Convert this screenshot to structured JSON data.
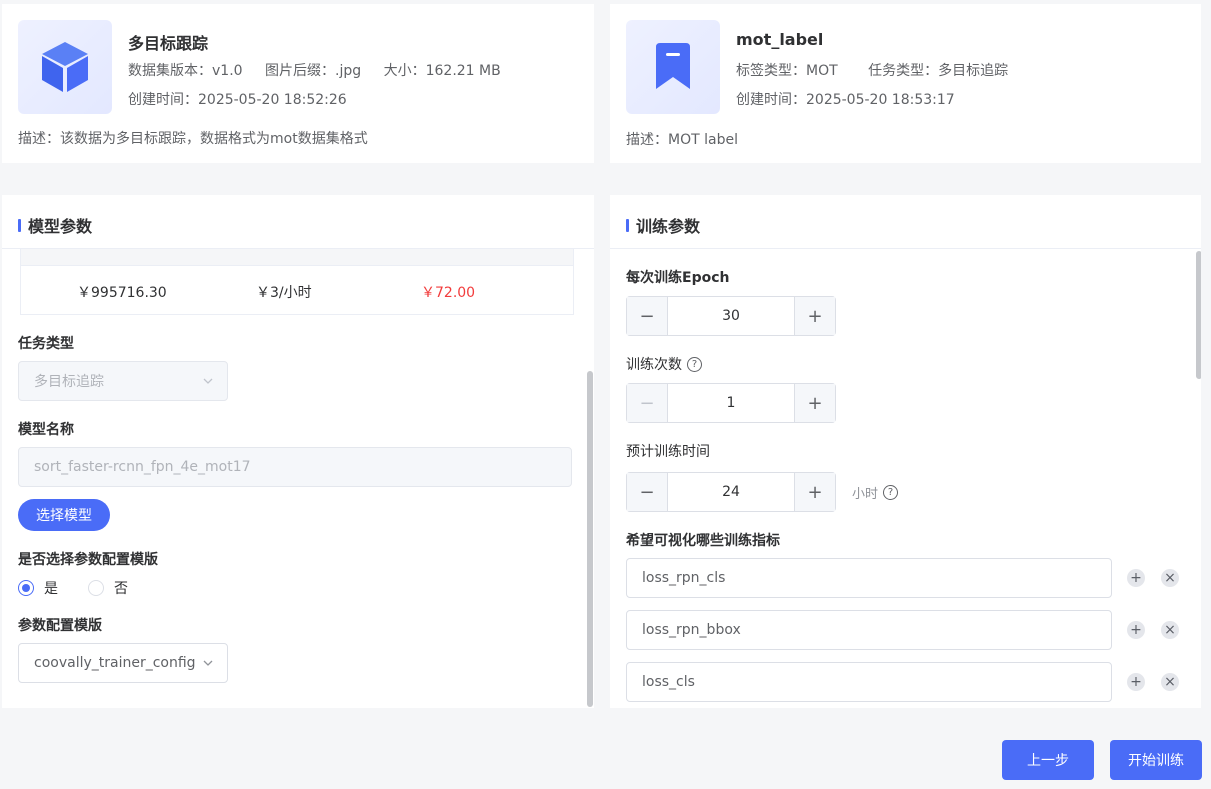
{
  "dataset_card": {
    "title": "多目标跟踪",
    "version_label": "数据集版本：",
    "version": "v1.0",
    "suffix_label": "图片后缀：",
    "suffix": ".jpg",
    "size_label": "大小：",
    "size": "162.21 MB",
    "created_label": "创建时间：",
    "created": "2025-05-20 18:52:26",
    "desc_label": "描述：",
    "desc": "该数据为多目标跟踪，数据格式为mot数据集格式",
    "icon": "cube-icon"
  },
  "label_card": {
    "title": "mot_label",
    "label_type_label": "标签类型：",
    "label_type": "MOT",
    "task_type_label": "任务类型：",
    "task_type": "多目标追踪",
    "created_label": "创建时间：",
    "created": "2025-05-20 18:53:17",
    "desc_label": "描述：",
    "desc": "MOT label",
    "icon": "bookmark-icon"
  },
  "model_params": {
    "title": "模型参数",
    "price_row": {
      "balance": "￥995716.30",
      "rate": "￥3/小时",
      "total": "￥72.00"
    },
    "task_type_label": "任务类型",
    "task_type_value": "多目标追踪",
    "model_name_label": "模型名称",
    "model_name_value": "sort_faster-rcnn_fpn_4e_mot17",
    "select_model_button": "选择模型",
    "use_template_label": "是否选择参数配置模版",
    "radio_yes": "是",
    "radio_no": "否",
    "template_label": "参数配置模版",
    "template_value": "coovally_trainer_config"
  },
  "train_params": {
    "title": "训练参数",
    "epoch_label": "每次训练Epoch",
    "epoch_value": "30",
    "times_label": "训练次数",
    "times_value": "1",
    "est_time_label": "预计训练时间",
    "est_time_value": "24",
    "est_time_unit": "小时",
    "metrics_label": "希望可视化哪些训练指标",
    "metrics": [
      "loss_rpn_cls",
      "loss_rpn_bbox",
      "loss_cls"
    ]
  },
  "footer": {
    "prev_button": "上一步",
    "start_button": "开始训练"
  },
  "colors": {
    "accent": "#4a6cf7",
    "price_red": "#f23c3c"
  }
}
